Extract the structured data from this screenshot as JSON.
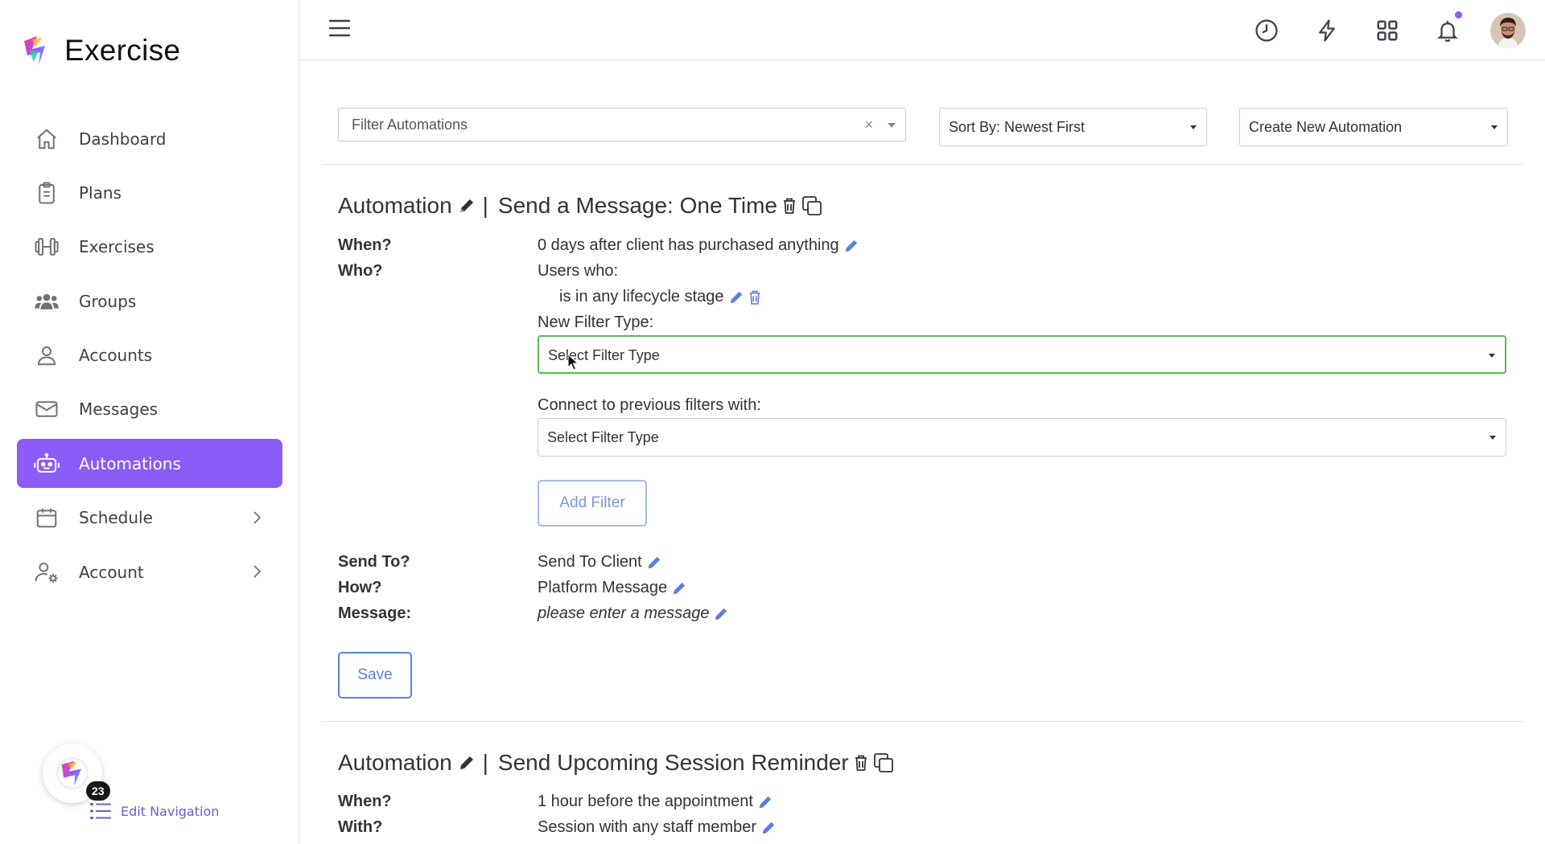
{
  "app": {
    "name": "Exercise"
  },
  "sidebar": {
    "items": [
      {
        "label": "Dashboard",
        "icon": "home-icon"
      },
      {
        "label": "Plans",
        "icon": "clipboard-icon"
      },
      {
        "label": "Exercises",
        "icon": "dumbbell-icon"
      },
      {
        "label": "Groups",
        "icon": "users-icon"
      },
      {
        "label": "Accounts",
        "icon": "user-icon"
      },
      {
        "label": "Messages",
        "icon": "envelope-icon"
      },
      {
        "label": "Automations",
        "icon": "robot-icon",
        "active": true
      },
      {
        "label": "Schedule",
        "icon": "calendar-icon",
        "has_submenu": true
      },
      {
        "label": "Account",
        "icon": "user-gear-icon",
        "has_submenu": true
      }
    ],
    "badge_count": "23",
    "edit_navigation_label": "Edit Navigation"
  },
  "topbar": {
    "icons": [
      "history-icon",
      "bolt-icon",
      "grid-icon",
      "bell-icon"
    ],
    "has_notification": true
  },
  "toolbar": {
    "filter_placeholder": "Filter Automations",
    "clear_symbol": "×",
    "sort_label": "Sort By: Newest First",
    "create_label": "Create New Automation"
  },
  "automations": [
    {
      "prefix": "Automation",
      "separator": "|",
      "name": "Send a Message: One Time",
      "when_label": "When?",
      "when_value": "0 days after client has purchased anything",
      "who_label": "Who?",
      "who_value": "Users who:",
      "filter_value": "is in any lifecycle stage",
      "new_filter_label": "New Filter Type:",
      "new_filter_select": "Select Filter Type",
      "connect_label": "Connect to previous filters with:",
      "connect_select": "Select Filter Type",
      "add_filter_label": "Add Filter",
      "send_to_label": "Send To?",
      "send_to_value": "Send To Client",
      "how_label": "How?",
      "how_value": "Platform Message",
      "message_label": "Message:",
      "message_value": "please enter a message",
      "save_label": "Save"
    },
    {
      "prefix": "Automation",
      "separator": "|",
      "name": "Send Upcoming Session Reminder",
      "when_label": "When?",
      "when_value": "1 hour before the appointment",
      "with_label": "With?",
      "with_value": "Session with any staff member"
    }
  ],
  "colors": {
    "accent": "#8b5cf6",
    "link_blue": "#5b7fe0",
    "focus_green": "#5cb85c"
  }
}
